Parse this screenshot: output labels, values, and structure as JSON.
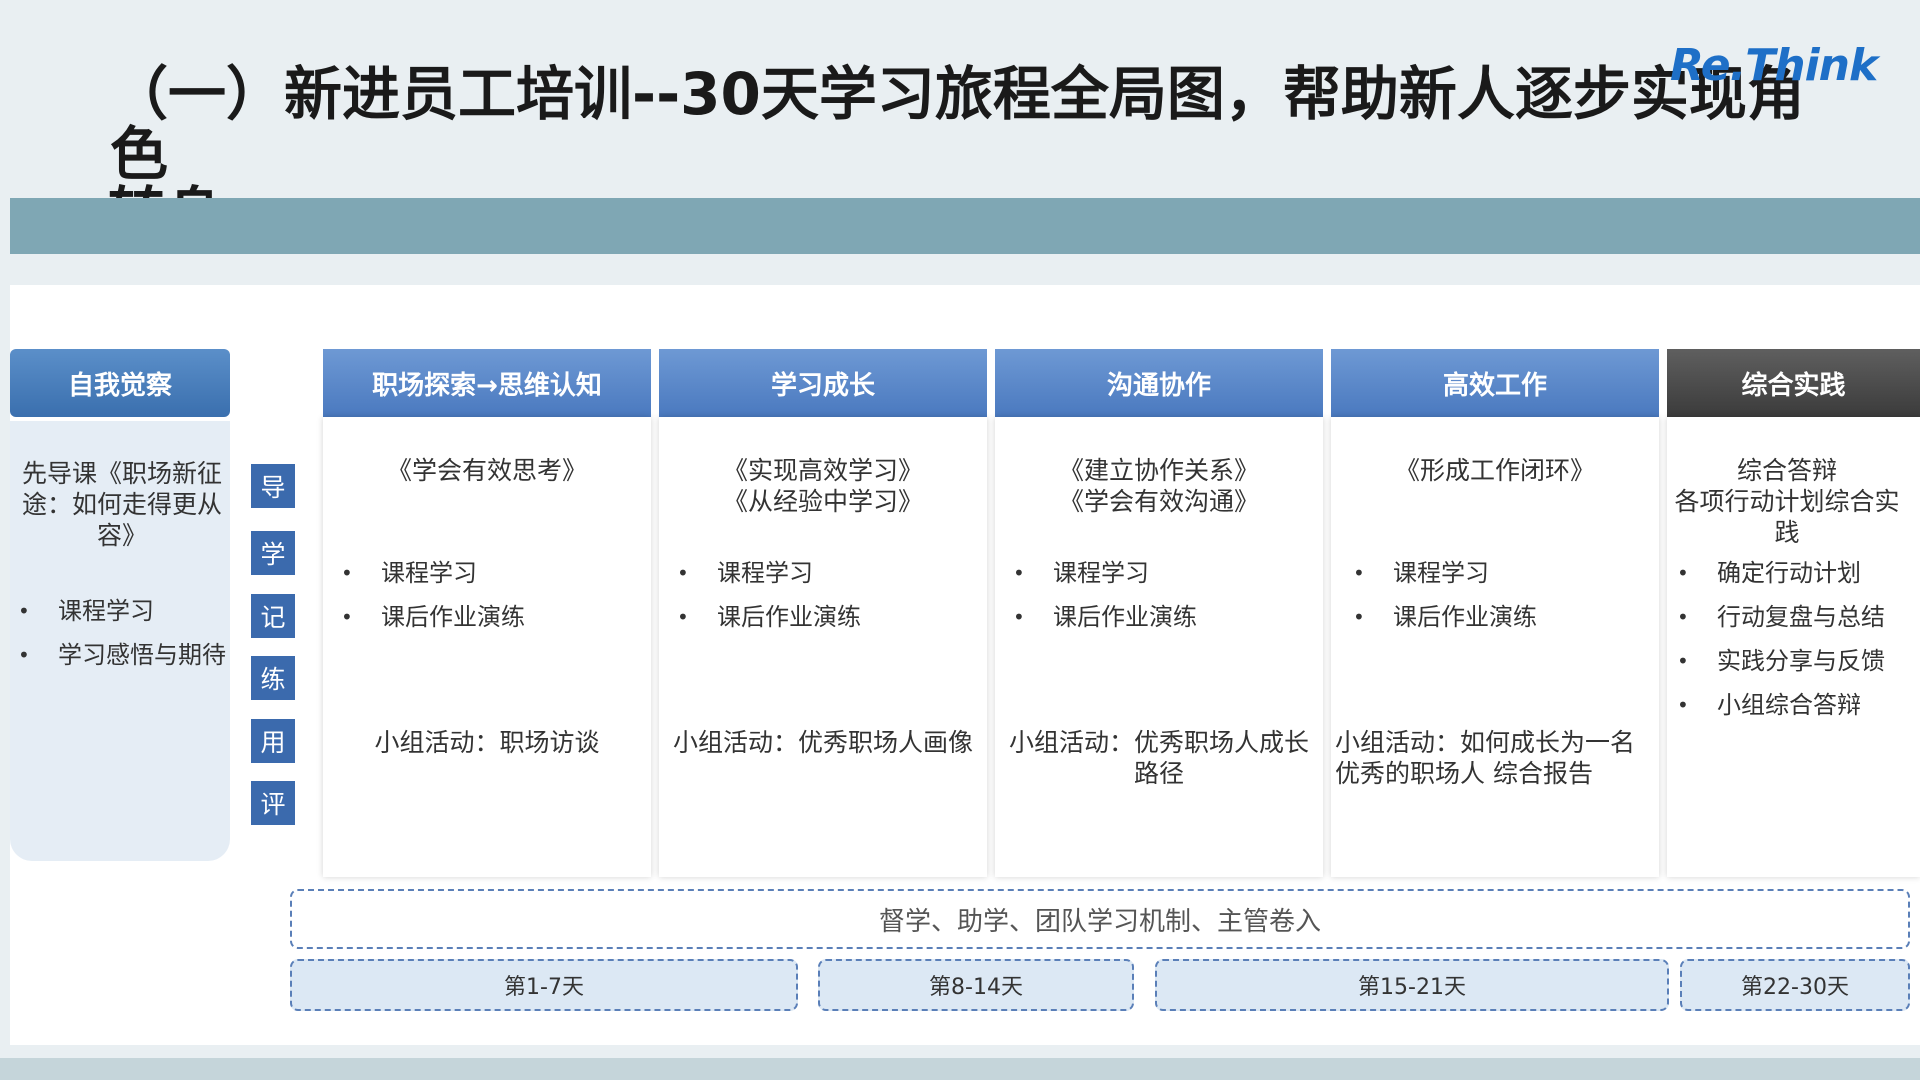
{
  "slide": {
    "title_line1": "（一）新进员工培训--30天学习旅程全局图，帮助新人逐步实现角色",
    "title_line2": "转身",
    "logo": "Re.Think"
  },
  "self_awareness": {
    "header": "自我觉察",
    "intro": "先导课《职场新征途：如何走得更从容》",
    "bullets": [
      "课程学习",
      "学习感悟与期待"
    ]
  },
  "verbs": [
    "导",
    "学",
    "记",
    "练",
    "用",
    "评"
  ],
  "stages": [
    {
      "header": "职场探索→思维认知",
      "course": "《学会有效思考》",
      "bullets": [
        "课程学习",
        "课后作业演练"
      ],
      "activity": "小组活动：职场访谈"
    },
    {
      "header": "学习成长",
      "course": "《实现高效学习》\n《从经验中学习》",
      "bullets": [
        "课程学习",
        "课后作业演练"
      ],
      "activity": "小组活动：优秀职场人画像"
    },
    {
      "header": "沟通协作",
      "course": "《建立协作关系》\n《学会有效沟通》",
      "bullets": [
        "课程学习",
        "课后作业演练"
      ],
      "activity": "小组活动：优秀职场人成长路径"
    },
    {
      "header": "高效工作",
      "course": "《形成工作闭环》",
      "bullets": [
        "课程学习",
        "课后作业演练"
      ],
      "activity": "小组活动：如何成长为一名优秀的职场人 综合报告"
    },
    {
      "header": "综合实践",
      "course": "综合答辩\n各项行动计划综合实践",
      "bullets": [
        "确定行动计划",
        "行动复盘与总结",
        "实践分享与反馈",
        "小组综合答辩"
      ],
      "activity": ""
    }
  ],
  "support_bar": "督学、助学、团队学习机制、主管卷入",
  "day_ranges": [
    "第1-7天",
    "第8-14天",
    "第15-21天",
    "第22-30天"
  ]
}
